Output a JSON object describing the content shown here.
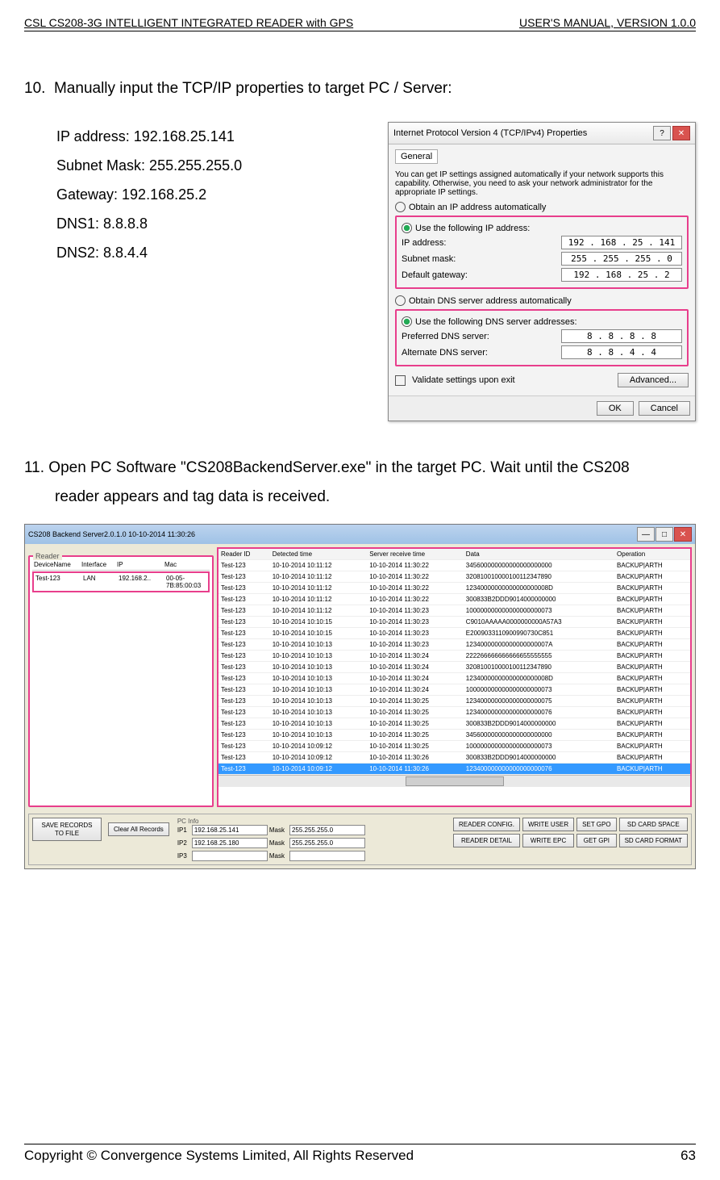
{
  "header": {
    "left": "CSL CS208-3G INTELLIGENT INTEGRATED READER with GPS",
    "right": "USER'S  MANUAL,  VERSION  1.0.0"
  },
  "step10": {
    "num": "10.",
    "text": "Manually input the TCP/IP properties to target PC / Server:",
    "ip_label": "IP address: 192.168.25.141",
    "subnet_label": "Subnet Mask: 255.255.255.0",
    "gateway_label": "Gateway: 192.168.25.2",
    "dns1_label": "DNS1: 8.8.8.8",
    "dns2_label": "DNS2: 8.8.4.4"
  },
  "dialog": {
    "title": "Internet Protocol Version 4 (TCP/IPv4) Properties",
    "tab": "General",
    "desc": "You can get IP settings assigned automatically if your network supports this capability. Otherwise, you need to ask your network administrator for the appropriate IP settings.",
    "radio_auto_ip": "Obtain an IP address automatically",
    "radio_use_ip": "Use the following IP address:",
    "ip_addr_lbl": "IP address:",
    "ip_addr_val": "192 . 168 .  25 . 141",
    "subnet_lbl": "Subnet mask:",
    "subnet_val": "255 . 255 . 255 .  0",
    "gateway_lbl": "Default gateway:",
    "gateway_val": "192 . 168 .  25 .  2",
    "radio_auto_dns": "Obtain DNS server address automatically",
    "radio_use_dns": "Use the following DNS server addresses:",
    "pref_dns_lbl": "Preferred DNS server:",
    "pref_dns_val": "8  .  8  .  8  .  8",
    "alt_dns_lbl": "Alternate DNS server:",
    "alt_dns_val": "8  .  8  .  4  .  4",
    "validate": "Validate settings upon exit",
    "advanced": "Advanced...",
    "ok": "OK",
    "cancel": "Cancel"
  },
  "step11": {
    "num": "11.",
    "text_a": "Open PC Software \"CS208BackendServer.exe\" in the target PC. Wait until the CS208",
    "text_b": "reader appears and tag data is received."
  },
  "app": {
    "title": "CS208 Backend Server2.0.1.0  10-10-2014 11:30:26",
    "reader_group": "Reader",
    "reader_hdr": {
      "c1": "DeviceName",
      "c2": "Interface",
      "c3": "IP",
      "c4": "Mac"
    },
    "reader_row": {
      "c1": "Test-123",
      "c2": "LAN",
      "c3": "192.168.2..",
      "c4": "00-05-7B:85:00:03"
    },
    "data_hdr": {
      "c1": "Reader ID",
      "c2": "Detected time",
      "c3": "Server receive time",
      "c4": "Data",
      "c5": "Operation"
    },
    "rows": [
      {
        "c1": "Test-123",
        "c2": "10-10-2014 10:11:12",
        "c3": "10-10-2014 11:30:22",
        "c4": "345600000000000000000000",
        "c5": "BACKUP|ARTH"
      },
      {
        "c1": "Test-123",
        "c2": "10-10-2014 10:11:12",
        "c3": "10-10-2014 11:30:22",
        "c4": "320810010000100112347890",
        "c5": "BACKUP|ARTH"
      },
      {
        "c1": "Test-123",
        "c2": "10-10-2014 10:11:12",
        "c3": "10-10-2014 11:30:22",
        "c4": "12340000000000000000008D",
        "c5": "BACKUP|ARTH"
      },
      {
        "c1": "Test-123",
        "c2": "10-10-2014 10:11:12",
        "c3": "10-10-2014 11:30:22",
        "c4": "300833B2DDD9014000000000",
        "c5": "BACKUP|ARTH"
      },
      {
        "c1": "Test-123",
        "c2": "10-10-2014 10:11:12",
        "c3": "10-10-2014 11:30:23",
        "c4": "100000000000000000000073",
        "c5": "BACKUP|ARTH"
      },
      {
        "c1": "Test-123",
        "c2": "10-10-2014 10:10:15",
        "c3": "10-10-2014 11:30:23",
        "c4": "C9010AAAAA0000000000A57A3",
        "c5": "BACKUP|ARTH"
      },
      {
        "c1": "Test-123",
        "c2": "10-10-2014 10:10:15",
        "c3": "10-10-2014 11:30:23",
        "c4": "E2009033110900990730C851",
        "c5": "BACKUP|ARTH"
      },
      {
        "c1": "Test-123",
        "c2": "10-10-2014 10:10:13",
        "c3": "10-10-2014 11:30:23",
        "c4": "12340000000000000000007A",
        "c5": "BACKUP|ARTH"
      },
      {
        "c1": "Test-123",
        "c2": "10-10-2014 10:10:13",
        "c3": "10-10-2014 11:30:24",
        "c4": "222266666666666655555555",
        "c5": "BACKUP|ARTH"
      },
      {
        "c1": "Test-123",
        "c2": "10-10-2014 10:10:13",
        "c3": "10-10-2014 11:30:24",
        "c4": "320810010000100112347890",
        "c5": "BACKUP|ARTH"
      },
      {
        "c1": "Test-123",
        "c2": "10-10-2014 10:10:13",
        "c3": "10-10-2014 11:30:24",
        "c4": "12340000000000000000008D",
        "c5": "BACKUP|ARTH"
      },
      {
        "c1": "Test-123",
        "c2": "10-10-2014 10:10:13",
        "c3": "10-10-2014 11:30:24",
        "c4": "100000000000000000000073",
        "c5": "BACKUP|ARTH"
      },
      {
        "c1": "Test-123",
        "c2": "10-10-2014 10:10:13",
        "c3": "10-10-2014 11:30:25",
        "c4": "123400000000000000000075",
        "c5": "BACKUP|ARTH"
      },
      {
        "c1": "Test-123",
        "c2": "10-10-2014 10:10:13",
        "c3": "10-10-2014 11:30:25",
        "c4": "123400000000000000000076",
        "c5": "BACKUP|ARTH"
      },
      {
        "c1": "Test-123",
        "c2": "10-10-2014 10:10:13",
        "c3": "10-10-2014 11:30:25",
        "c4": "300833B2DDD9014000000000",
        "c5": "BACKUP|ARTH"
      },
      {
        "c1": "Test-123",
        "c2": "10-10-2014 10:10:13",
        "c3": "10-10-2014 11:30:25",
        "c4": "345600000000000000000000",
        "c5": "BACKUP|ARTH"
      },
      {
        "c1": "Test-123",
        "c2": "10-10-2014 10:09:12",
        "c3": "10-10-2014 11:30:25",
        "c4": "100000000000000000000073",
        "c5": "BACKUP|ARTH"
      },
      {
        "c1": "Test-123",
        "c2": "10-10-2014 10:09:12",
        "c3": "10-10-2014 11:30:26",
        "c4": "300833B2DDD9014000000000",
        "c5": "BACKUP|ARTH"
      },
      {
        "c1": "Test-123",
        "c2": "10-10-2014 10:09:12",
        "c3": "10-10-2014 11:30:26",
        "c4": "123400000000000000000076",
        "c5": "BACKUP|ARTH"
      }
    ],
    "save_btn": "SAVE RECORDS TO FILE",
    "clear_btn": "Clear All Records",
    "pcinfo_label": "PC Info",
    "ip1_lbl": "IP1",
    "ip1_val": "192.168.25.141",
    "ip1_mask_lbl": "Mask",
    "ip1_mask_val": "255.255.255.0",
    "ip2_lbl": "IP2",
    "ip2_val": "192.168.25.180",
    "ip2_mask_lbl": "Mask",
    "ip2_mask_val": "255.255.255.0",
    "ip3_lbl": "IP3",
    "ip3_val": "",
    "ip3_mask_lbl": "Mask",
    "ip3_mask_val": "",
    "btns": {
      "reader_config": "READER CONFIG.",
      "write_user": "WRITE USER",
      "set_gpo": "SET GPO",
      "sd_space": "SD CARD SPACE",
      "reader_detail": "READER DETAIL",
      "write_epc": "WRITE EPC",
      "get_gpi": "GET GPI",
      "sd_format": "SD CARD FORMAT"
    }
  },
  "footer": {
    "left": "Copyright © Convergence Systems Limited, All Rights Reserved",
    "right": "63"
  }
}
